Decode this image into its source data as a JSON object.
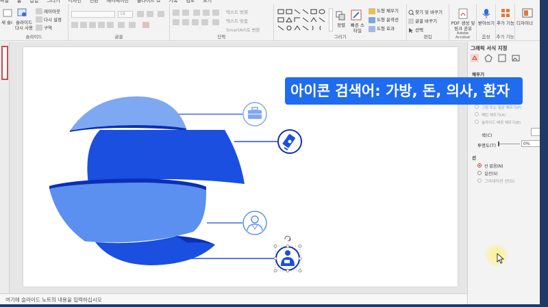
{
  "ribbon": {
    "menu_items": [
      "파일",
      "홈",
      "삽입",
      "그리기",
      "디자인",
      "전환",
      "애니메이션",
      "슬라이드 쇼",
      "기록",
      "검토",
      "보기"
    ],
    "slides_group": {
      "new_slide": "새 슬라이드",
      "reuse_slide": "슬라이드 다시 사용",
      "layout": "레이아웃",
      "reset": "다시 설정",
      "section": "구역",
      "label": "슬라이드"
    },
    "font_group": {
      "font_size": "18",
      "label": "글꼴"
    },
    "paragraph_group": {
      "text_direction": "텍스트 방향",
      "align_text": "텍스트 맞춤",
      "smartart": "SmartArt로 변환",
      "label": "단락"
    },
    "drawing_group": {
      "arrange": "정렬",
      "quick_styles": "빠른 스타일",
      "fill": "도형 채우기",
      "outline": "도형 윤곽선",
      "effects": "도형 효과",
      "label": "그리기"
    },
    "editing_group": {
      "find": "찾기 및 바꾸기",
      "replace": "글꼴 바꾸기",
      "select": "선택",
      "label": "편집"
    },
    "acrobat_group": {
      "create_pdf": "PDF 생성 및 링크 공유",
      "label": "Adobe Acrobat"
    },
    "voice_group": {
      "dictate": "받아쓰기",
      "label": "음성"
    },
    "addins_group": {
      "addins": "추가 기능",
      "label": "추가 기능"
    },
    "designer_group": {
      "designer": "디자이너"
    }
  },
  "caption": {
    "text": "아이콘 검색어: 가방, 돈, 의사, 환자"
  },
  "slide": {
    "icons": [
      "briefcase-icon",
      "money-icon",
      "doctor-icon",
      "patient-icon"
    ],
    "colors": {
      "light_blue": "#7ea8f2",
      "mid_blue": "#5b8ff0",
      "deep_blue": "#1a4fe0",
      "dark_blue": "#0b2fb5",
      "icon_blue": "#1e4fd1"
    }
  },
  "notes": {
    "placeholder": "여기에 슬라이드 노트의 내용을 입력하십시오"
  },
  "pane": {
    "title": "그래픽 서식 지정",
    "fill_section": "채우기",
    "fill_options": [
      "그림 또는 질감 채우기(P)",
      "패턴 채우기(A)",
      "슬라이드 배경 채우기(B)"
    ],
    "color_label": "색(C)",
    "transparency_label": "투명도(T)",
    "transparency_value": "0%",
    "line_section": "선",
    "line_options": [
      "선 없음(N)",
      "실선(S)",
      "그라데이션 선(G)"
    ],
    "line_selected": 0
  }
}
